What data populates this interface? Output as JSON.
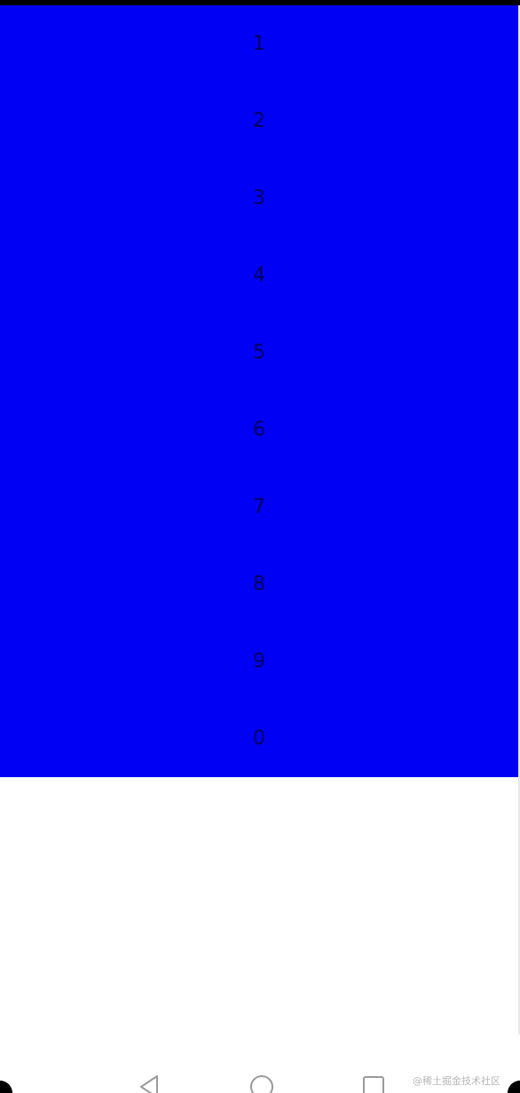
{
  "numbers": [
    "1",
    "2",
    "3",
    "4",
    "5",
    "6",
    "7",
    "8",
    "9",
    "0"
  ],
  "colors": {
    "list_background": "#0000f5",
    "number_text": "#000055",
    "page_background": "#ffffff"
  },
  "nav_bar": {
    "back_icon": "triangle-back-icon",
    "home_icon": "circle-home-icon",
    "recent_icon": "square-recent-icon"
  },
  "watermark": "@稀土掘金技术社区"
}
